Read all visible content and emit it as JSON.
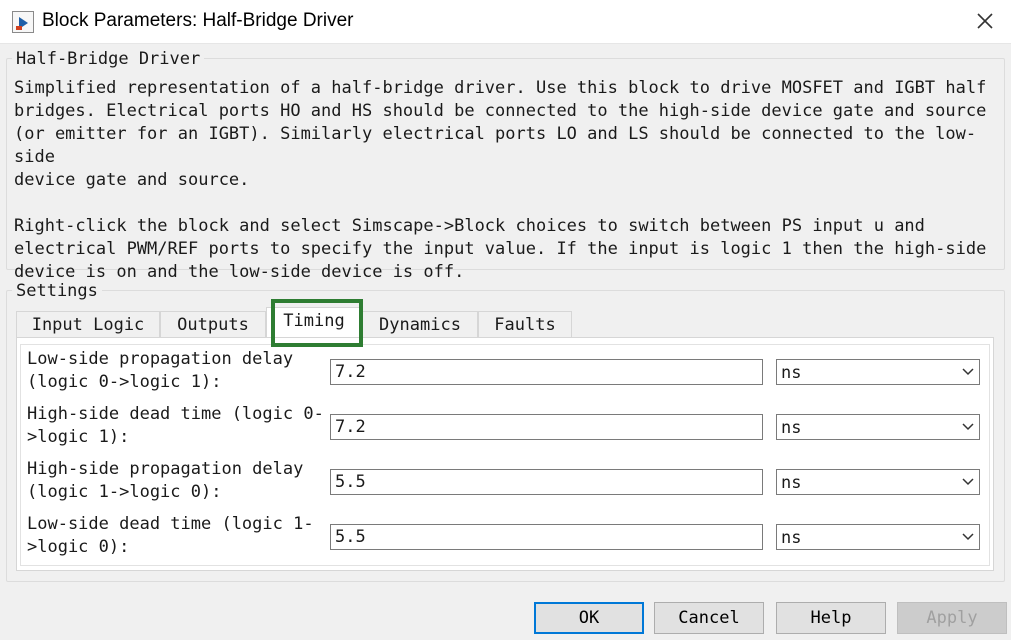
{
  "window": {
    "title": "Block Parameters: Half-Bridge Driver",
    "app_icon": "simulink-block-icon",
    "close_icon": "close-icon"
  },
  "description": {
    "legend": "Half-Bridge Driver",
    "paragraph1": "Simplified representation of a half-bridge driver. Use this block to drive MOSFET and IGBT half\nbridges. Electrical ports HO and HS should be connected to the high-side device gate and source\n(or emitter for an IGBT). Similarly electrical ports LO and LS should be connected to the low-side\ndevice gate and source.",
    "paragraph2": "Right-click the block and select Simscape->Block choices to switch between PS input u and\nelectrical PWM/REF ports to specify the input value. If the input is logic 1 then the high-side\ndevice is on and the low-side device is off."
  },
  "settings": {
    "legend": "Settings",
    "tabs": [
      {
        "label": "Input Logic",
        "active": false
      },
      {
        "label": "Outputs",
        "active": false
      },
      {
        "label": "Timing",
        "active": true
      },
      {
        "label": "Dynamics",
        "active": false
      },
      {
        "label": "Faults",
        "active": false
      }
    ],
    "highlight_color": "#2e7d32",
    "params": [
      {
        "label": "Low-side propagation delay\n(logic 0->logic 1):",
        "value": "7.2",
        "unit": "ns"
      },
      {
        "label": "High-side dead time (logic 0-\n>logic 1):",
        "value": "7.2",
        "unit": "ns"
      },
      {
        "label": "High-side propagation delay\n(logic 1->logic 0):",
        "value": "5.5",
        "unit": "ns"
      },
      {
        "label": "Low-side dead time (logic 1-\n>logic 0):",
        "value": "5.5",
        "unit": "ns"
      }
    ]
  },
  "buttons": {
    "ok": "OK",
    "cancel": "Cancel",
    "help": "Help",
    "apply": "Apply"
  }
}
